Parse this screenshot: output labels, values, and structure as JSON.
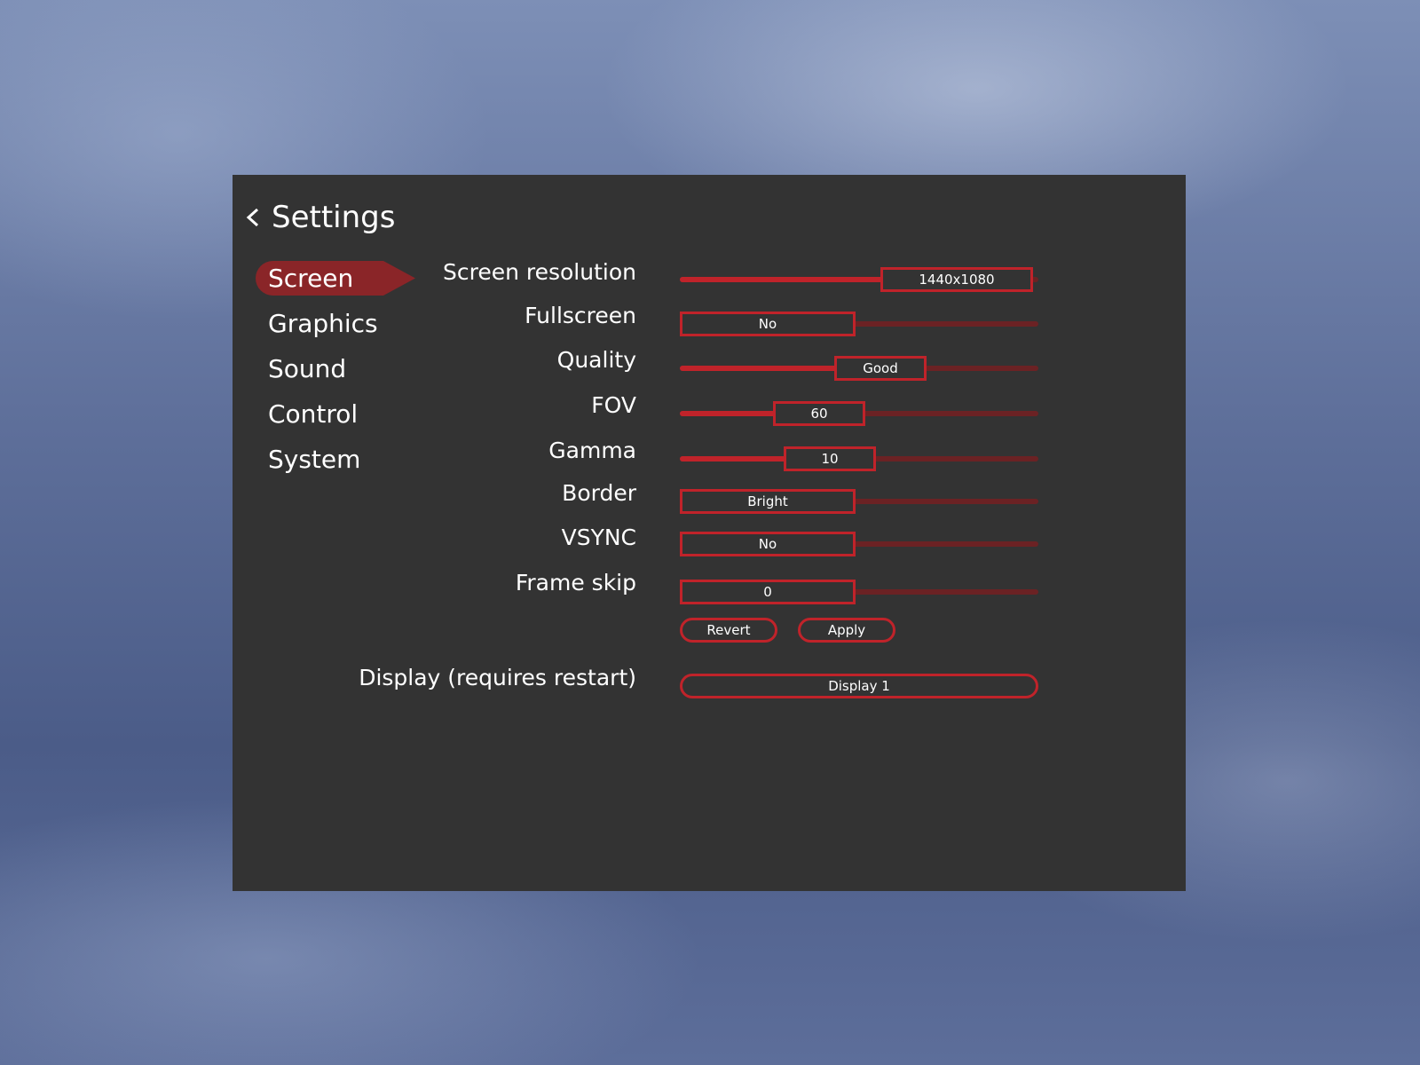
{
  "header": {
    "title": "Settings",
    "back_icon": "chevron-left-icon"
  },
  "sidebar": {
    "items": [
      {
        "label": "Screen",
        "active": true
      },
      {
        "label": "Graphics",
        "active": false
      },
      {
        "label": "Sound",
        "active": false
      },
      {
        "label": "Control",
        "active": false
      },
      {
        "label": "System",
        "active": false
      }
    ]
  },
  "settings": {
    "screen_resolution": {
      "label": "Screen resolution",
      "value": "1440x1080",
      "level": 0.56
    },
    "fullscreen": {
      "label": "Fullscreen",
      "value": "No",
      "level": 0.0
    },
    "quality": {
      "label": "Quality",
      "value": "Good",
      "level": 0.43
    },
    "fov": {
      "label": "FOV",
      "value": "60",
      "level": 0.26
    },
    "gamma": {
      "label": "Gamma",
      "value": "10",
      "level": 0.29
    },
    "border": {
      "label": "Border",
      "value": "Bright",
      "level": 0.0
    },
    "vsync": {
      "label": "VSYNC",
      "value": "No",
      "level": 0.0
    },
    "frame_skip": {
      "label": "Frame skip",
      "value": "0",
      "level": 0.0
    },
    "display": {
      "label": "Display (requires restart)",
      "value": "Display 1"
    }
  },
  "actions": {
    "revert_label": "Revert",
    "apply_label": "Apply"
  },
  "colors": {
    "panel_bg": "#333333",
    "accent": "#c0232a",
    "track_inactive": "#6b2224",
    "nav_active_bg": "#8a2528",
    "text": "#ffffff"
  }
}
